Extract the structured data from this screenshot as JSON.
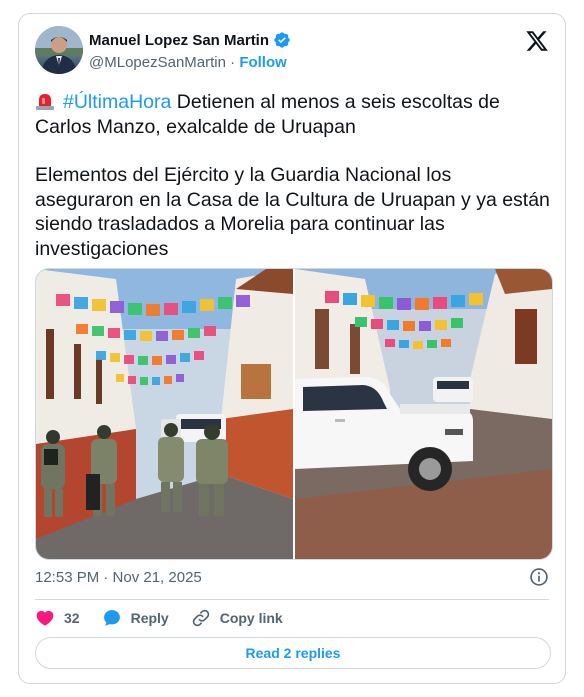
{
  "author": {
    "name": "Manuel Lopez San Martin",
    "handle": "@MLopezSanMartin",
    "separator": "·",
    "follow_label": "Follow"
  },
  "tweet": {
    "hashtag": "#ÚltimaHora",
    "line1_rest": " Detienen al menos a seis escoltas de Carlos Manzo, exalcalde de Uruapan",
    "paragraph2": "Elementos del Ejército y la Guardia Nacional los aseguraron en la Casa de la Cultura de Uruapan y ya están siendo trasladados a Morelia para continuar las investigaciones"
  },
  "timestamp": "12:53 PM · Nov 21, 2025",
  "actions": {
    "like_count": "32",
    "reply_label": "Reply",
    "copy_link_label": "Copy link"
  },
  "read_replies_label": "Read 2 replies",
  "colors": {
    "accent": "#1d9bf0",
    "text": "#0f1419",
    "muted": "#536471",
    "border": "#cfd9de",
    "like": "#f91880"
  },
  "icons": {
    "verified": "verified-badge-icon",
    "platform": "x-logo-icon",
    "emoji": "police-siren-icon",
    "info": "info-icon",
    "like": "heart-icon",
    "reply": "reply-bubble-icon",
    "copy": "link-icon"
  }
}
